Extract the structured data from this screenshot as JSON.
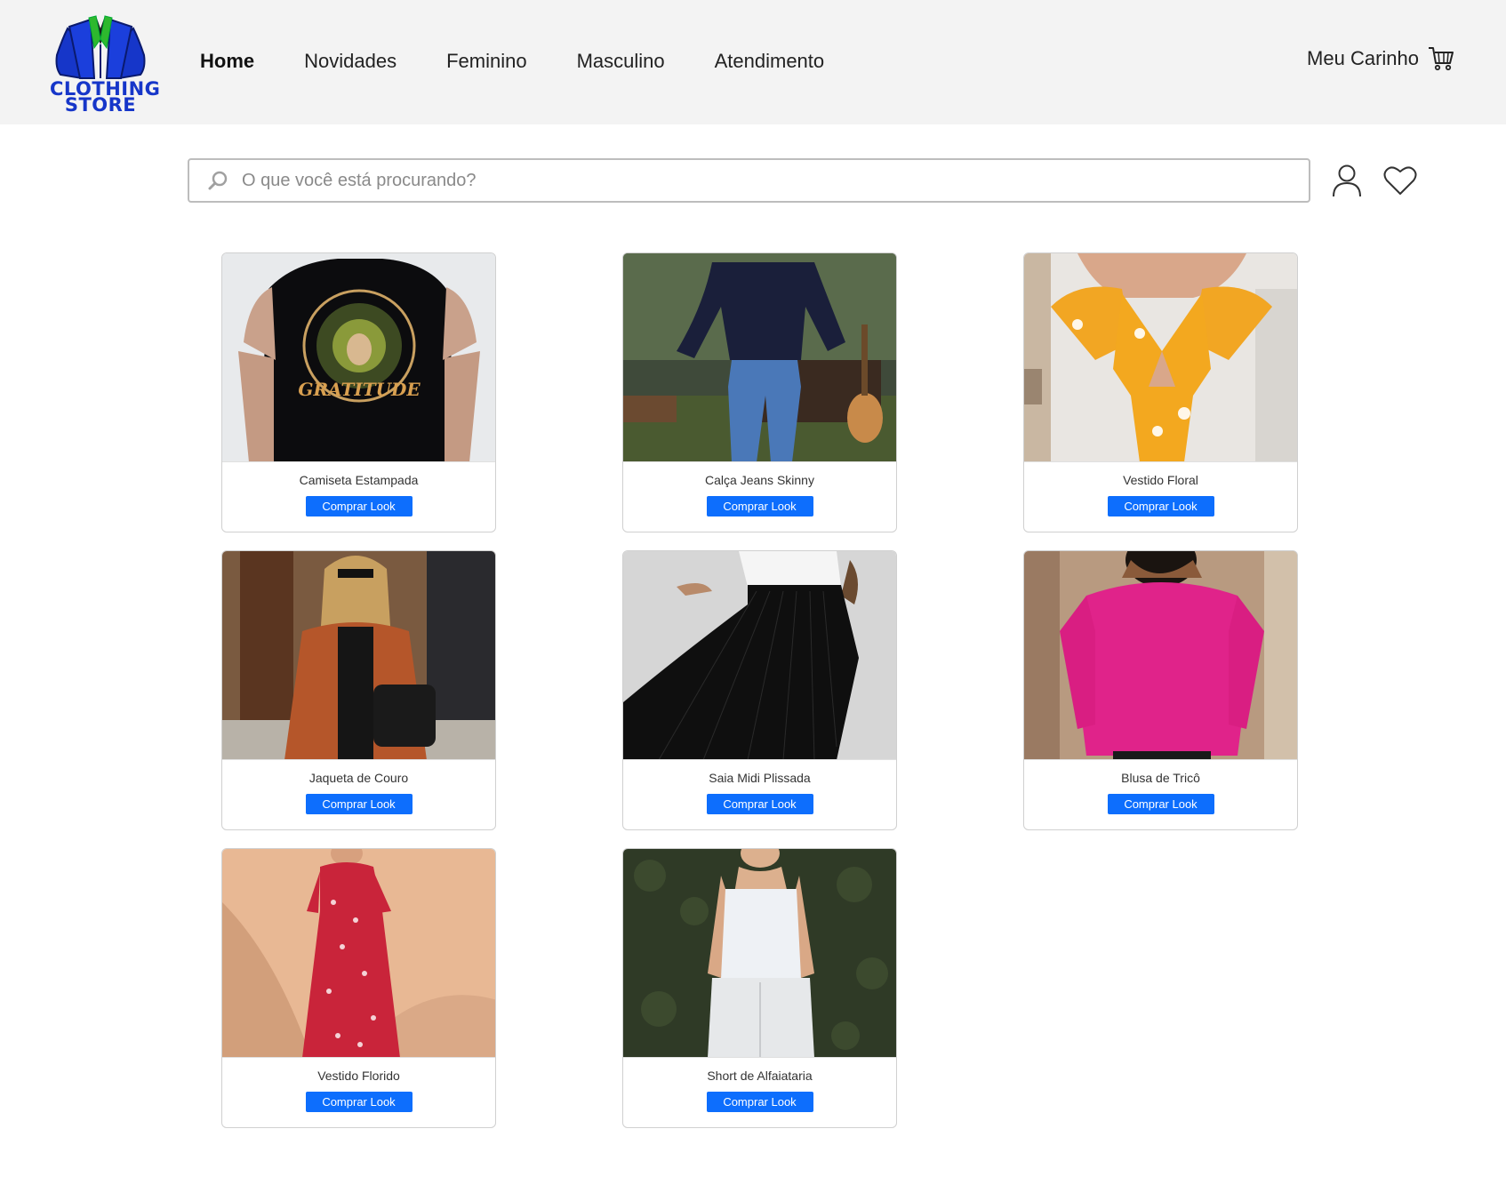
{
  "brand": {
    "logo_line1": "CLOTHING",
    "logo_line2": "STORE"
  },
  "nav": {
    "items": [
      {
        "label": "Home",
        "active": true
      },
      {
        "label": "Novidades",
        "active": false
      },
      {
        "label": "Feminino",
        "active": false
      },
      {
        "label": "Masculino",
        "active": false
      },
      {
        "label": "Atendimento",
        "active": false
      }
    ]
  },
  "cart": {
    "label": "Meu Carinho"
  },
  "search": {
    "placeholder": "O que você está procurando?",
    "value": ""
  },
  "products": [
    {
      "name": "Camiseta Estampada",
      "button": "Comprar Look"
    },
    {
      "name": "Calça Jeans Skinny",
      "button": "Comprar Look"
    },
    {
      "name": "Vestido Floral",
      "button": "Comprar Look"
    },
    {
      "name": "Jaqueta de Couro",
      "button": "Comprar Look"
    },
    {
      "name": "Saia Midi Plissada",
      "button": "Comprar Look"
    },
    {
      "name": "Blusa de Tricô",
      "button": "Comprar Look"
    },
    {
      "name": "Vestido Florido",
      "button": "Comprar Look"
    },
    {
      "name": "Short de Alfaiataria",
      "button": "Comprar Look"
    }
  ],
  "colors": {
    "accent": "#0d6efd",
    "header_bg": "#f3f3f3",
    "brand_blue": "#1636c9"
  }
}
